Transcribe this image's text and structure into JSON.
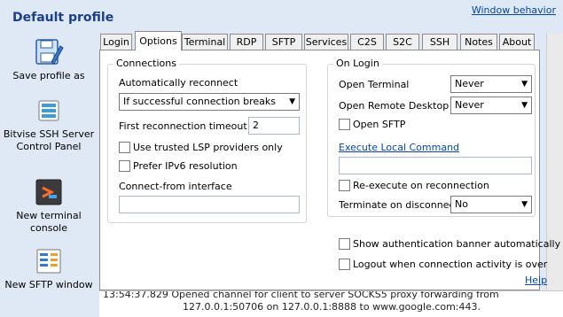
{
  "header": {
    "title": "Default profile",
    "window_behavior": "Window behavior"
  },
  "sidebar": {
    "items": [
      {
        "label": "Save profile as",
        "icon": "save-profile-icon"
      },
      {
        "label": "Bitvise SSH Server Control Panel",
        "icon": "server-control-panel-icon"
      },
      {
        "label": "New terminal console",
        "icon": "terminal-console-icon"
      },
      {
        "label": "New SFTP window",
        "icon": "sftp-window-icon"
      }
    ]
  },
  "tabs": [
    "Login",
    "Options",
    "Terminal",
    "RDP",
    "SFTP",
    "Services",
    "C2S",
    "S2C",
    "SSH",
    "Notes",
    "About"
  ],
  "active_tab": "Options",
  "connections": {
    "legend": "Connections",
    "auto_reconnect_label": "Automatically reconnect",
    "auto_reconnect_value": "If successful connection breaks",
    "first_timeout_label": "First reconnection timeout",
    "first_timeout_value": "2",
    "trusted_lsp_label": "Use trusted LSP providers only",
    "prefer_ipv6_label": "Prefer IPv6 resolution",
    "connect_from_label": "Connect-from interface",
    "connect_from_value": ""
  },
  "on_login": {
    "legend": "On Login",
    "open_terminal_label": "Open Terminal",
    "open_terminal_value": "Never",
    "open_rdp_label": "Open Remote Desktop",
    "open_rdp_value": "Never",
    "open_sftp_label": "Open SFTP",
    "execute_local_label": "Execute Local Command",
    "execute_local_value": "",
    "reexecute_label": "Re-execute on reconnection",
    "terminate_label": "Terminate on disconnect",
    "terminate_value": "No"
  },
  "bottom_options": {
    "show_banner_label": "Show authentication banner automatically",
    "logout_label": "Logout when connection activity is over"
  },
  "help_label": "Help",
  "log": {
    "line1": "13:54:37.829  Opened channel for client to server SOCKS5 proxy forwarding from",
    "line2": "127.0.0.1:50706 on 127.0.0.1:8888 to www.google.com:443."
  }
}
